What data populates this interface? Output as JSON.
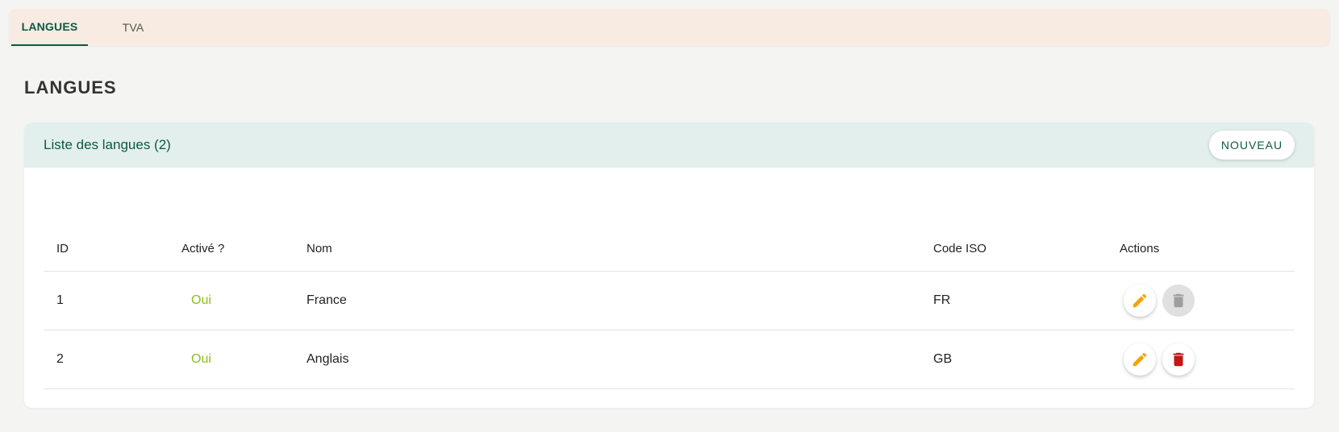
{
  "tabs": [
    {
      "label": "LANGUES",
      "active": true
    },
    {
      "label": "TVA",
      "active": false
    }
  ],
  "page": {
    "title": "LANGUES"
  },
  "card": {
    "title": "Liste des langues (2)",
    "new_button": "NOUVEAU"
  },
  "table": {
    "columns": [
      "ID",
      "Activé ?",
      "Nom",
      "Code ISO",
      "Actions"
    ],
    "rows": [
      {
        "id": "1",
        "active": "Oui",
        "nom": "France",
        "iso": "FR",
        "delete_enabled": false
      },
      {
        "id": "2",
        "active": "Oui",
        "nom": "Anglais",
        "iso": "GB",
        "delete_enabled": true
      }
    ]
  },
  "colors": {
    "primary": "#0b5a46",
    "tabbar_bg": "#f8ebe1",
    "card_header_bg": "#e3efec",
    "active_text": "#8bbf1a",
    "edit_icon": "#f5a300",
    "delete_icon": "#c41414",
    "delete_disabled_icon": "#9e9e9e"
  },
  "icons": {
    "edit": "pencil-icon",
    "delete": "trash-icon"
  }
}
